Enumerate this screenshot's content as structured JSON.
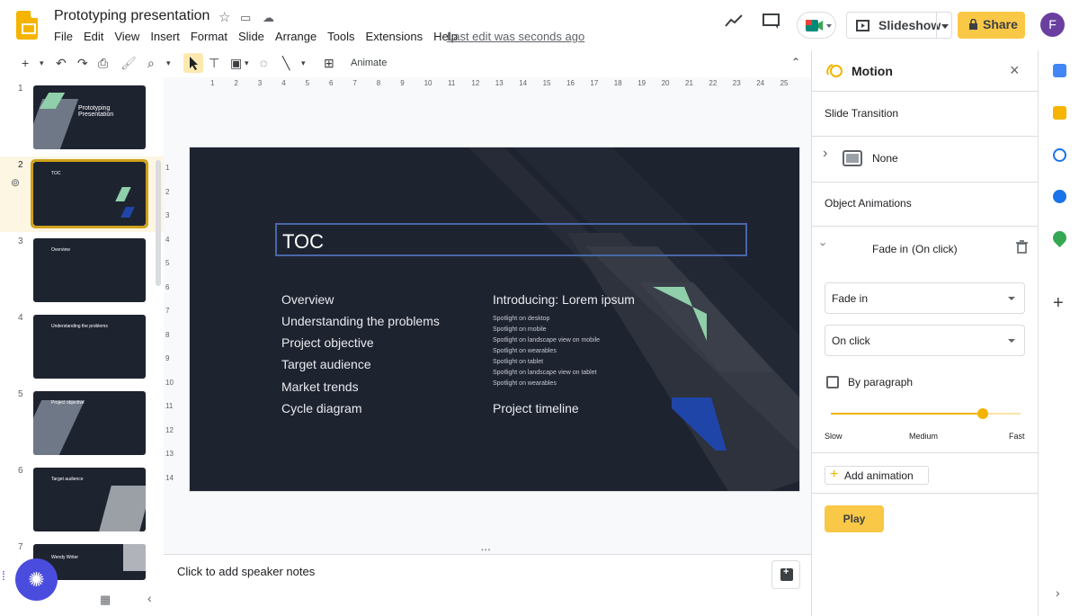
{
  "app": {
    "doc_title": "Prototyping presentation",
    "menu": [
      "File",
      "Edit",
      "View",
      "Insert",
      "Format",
      "Slide",
      "Arrange",
      "Tools",
      "Extensions",
      "Help"
    ],
    "last_edit": "Last edit was seconds ago",
    "slideshow_label": "Slideshow",
    "share_label": "Share",
    "avatar_letter": "F",
    "colors": {
      "accent": "#f9c846",
      "slide_bg": "#1e2330",
      "selection": "#d0a11a"
    }
  },
  "toolbar": {
    "animate_label": "Animate"
  },
  "filmstrip": {
    "slides": [
      {
        "num": "1",
        "title": "Prototyping Presentation"
      },
      {
        "num": "2",
        "title": "TOC"
      },
      {
        "num": "3",
        "title": "Overview"
      },
      {
        "num": "4",
        "title": "Understanding the problems"
      },
      {
        "num": "5",
        "title": "Project objective"
      },
      {
        "num": "6",
        "title": "Target audience"
      },
      {
        "num": "7",
        "title": "Wendy Writer"
      }
    ],
    "selected_index": 1
  },
  "ruler": {
    "h_ticks": [
      "1",
      "2",
      "3",
      "4",
      "5",
      "6",
      "7",
      "8",
      "9",
      "10",
      "11",
      "12",
      "13",
      "14",
      "15",
      "16",
      "17",
      "18",
      "19",
      "20",
      "21",
      "22",
      "23",
      "24",
      "25"
    ],
    "v_ticks": [
      "1",
      "2",
      "3",
      "4",
      "5",
      "6",
      "7",
      "8",
      "9",
      "10",
      "11",
      "12",
      "13",
      "14"
    ]
  },
  "slide": {
    "title": "TOC",
    "left_items": [
      "Overview",
      "Understanding the problems",
      "Project objective",
      "Target audience",
      "Market trends",
      "Cycle diagram"
    ],
    "right_heading": "Introducing: Lorem ipsum",
    "right_subitems": [
      "Spotlight on desktop",
      "Spotlight on mobile",
      "Spotlight on landscape view on mobile",
      "Spotlight on wearables",
      "Spotlight on tablet",
      "Spotlight on landscape view on tablet",
      "Spotlight on wearables"
    ],
    "right_footer": "Project timeline"
  },
  "notes": {
    "placeholder": "Click to add speaker notes"
  },
  "motion": {
    "title": "Motion",
    "slide_transition_label": "Slide Transition",
    "transition_value": "None",
    "object_animations_label": "Object Animations",
    "animation_item": "Fade in",
    "animation_trigger": "(On click)",
    "effect_select": "Fade in",
    "trigger_select": "On click",
    "by_paragraph_label": "By paragraph",
    "by_paragraph_checked": false,
    "speed_labels": {
      "slow": "Slow",
      "medium": "Medium",
      "fast": "Fast"
    },
    "speed_level": 0.8,
    "add_animation_label": "Add animation",
    "play_label": "Play"
  }
}
